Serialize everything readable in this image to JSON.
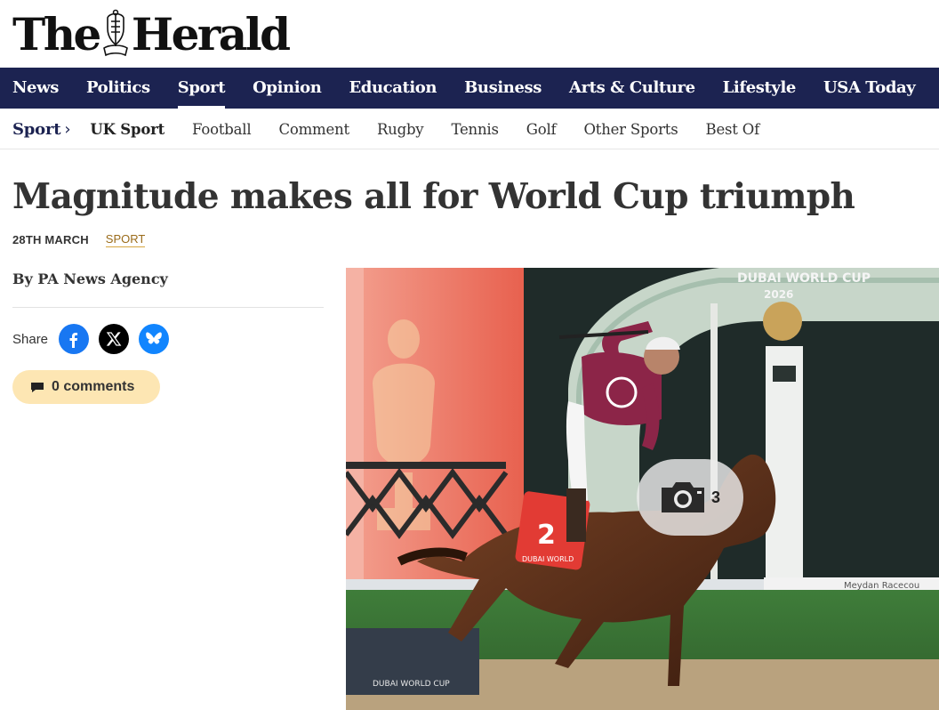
{
  "site": {
    "logo_text_left": "The",
    "logo_text_right": "Herald"
  },
  "main_nav": {
    "items": [
      {
        "label": "News",
        "active": false
      },
      {
        "label": "Politics",
        "active": false
      },
      {
        "label": "Sport",
        "active": true
      },
      {
        "label": "Opinion",
        "active": false
      },
      {
        "label": "Education",
        "active": false
      },
      {
        "label": "Business",
        "active": false
      },
      {
        "label": "Arts & Culture",
        "active": false
      },
      {
        "label": "Lifestyle",
        "active": false
      },
      {
        "label": "USA Today",
        "active": false
      }
    ]
  },
  "sub_nav": {
    "section": "Sport",
    "chevron": "›",
    "items": [
      "UK Sport",
      "Football",
      "Comment",
      "Rugby",
      "Tennis",
      "Golf",
      "Other Sports",
      "Best Of"
    ]
  },
  "article": {
    "headline": "Magnitude makes all for World Cup triumph",
    "date": "28TH MARCH",
    "tag": "SPORT",
    "byline": "By PA News Agency",
    "share_label": "Share",
    "comments_label": "0 comments"
  },
  "photo": {
    "gallery_count": "3",
    "sign_line1": "DUBAI WORLD CUP",
    "sign_line2": "2026",
    "rail_text": "Meydan Racecou",
    "saddle_number": "2",
    "saddle_text": "DUBAI WORLD",
    "board_text": "DUBAI WORLD CUP"
  },
  "colors": {
    "nav_bg": "#1c2351",
    "accent_gold": "#d6a642",
    "comments_bg": "#fde6b3",
    "facebook": "#1877f2",
    "bluesky": "#1185fe"
  },
  "icons": [
    "crest-icon",
    "chevron-right-icon",
    "facebook-icon",
    "x-icon",
    "bluesky-icon",
    "comment-icon",
    "camera-icon"
  ]
}
